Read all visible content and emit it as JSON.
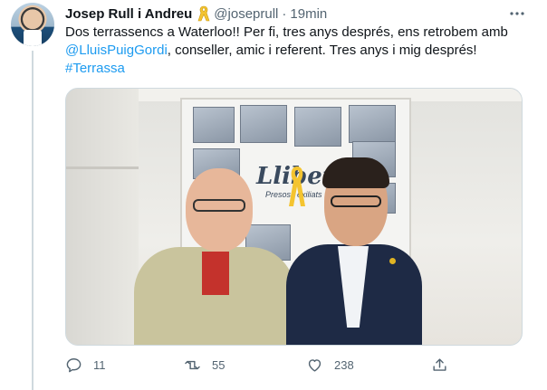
{
  "author": {
    "display_name": "Josep Rull i Andreu",
    "handle": "@joseprull",
    "separator": "·",
    "time": "19min",
    "badge_icon": "yellow-ribbon-icon"
  },
  "tweet": {
    "line1": "Dos terrassencs a Waterloo!! Per fi, tres anys després, ens retrobem amb",
    "mention": "@LluisPuigGordi",
    "line2_rest": ", conseller, amic i referent. Tres anys i mig després!",
    "hashtag": "#Terrassa"
  },
  "photo": {
    "poster_title": "Llibertat",
    "poster_subtitle": "Presos i exiliats"
  },
  "actions": {
    "reply_count": "11",
    "retweet_count": "55",
    "like_count": "238"
  },
  "colors": {
    "link": "#1d9bf0",
    "secondary_text": "#536471",
    "ribbon": "#f4c430"
  }
}
